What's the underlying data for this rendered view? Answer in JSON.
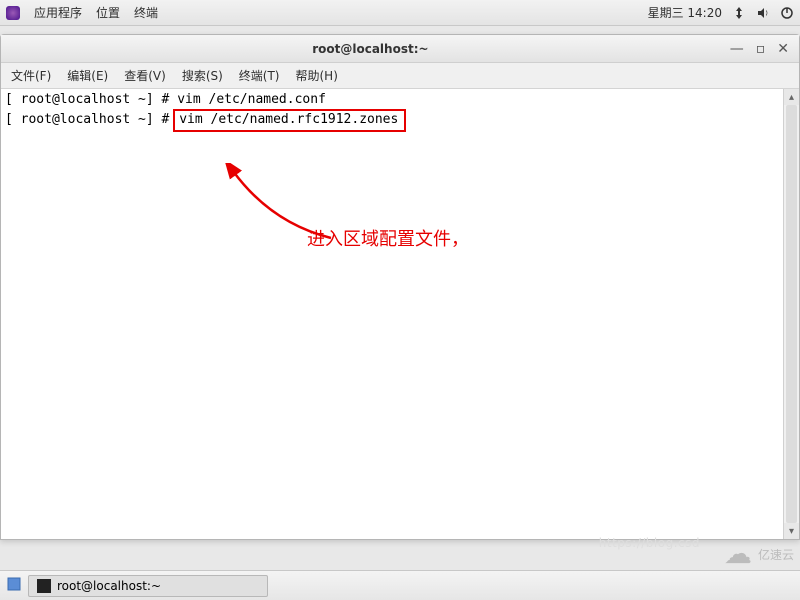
{
  "topbar": {
    "apps": "应用程序",
    "places": "位置",
    "terminal": "终端",
    "datetime": "星期三 14:20"
  },
  "window": {
    "title": "root@localhost:~"
  },
  "menubar": {
    "file": "文件(F)",
    "edit": "编辑(E)",
    "view": "查看(V)",
    "search": "搜索(S)",
    "terminal": "终端(T)",
    "help": "帮助(H)"
  },
  "terminal": {
    "line1_prompt": "[ root@localhost ~] # ",
    "line1_cmd": "vim /etc/named.conf",
    "line2_prompt": "[ root@localhost ~] # ",
    "line2_cmd": "vim /etc/named.rfc1912.zones"
  },
  "annotation": {
    "text": "进入区域配置文件，"
  },
  "taskbar": {
    "entry": "root@localhost:~"
  },
  "watermark": {
    "brand": "亿速云",
    "url_fragment": "https://blog.csd"
  }
}
